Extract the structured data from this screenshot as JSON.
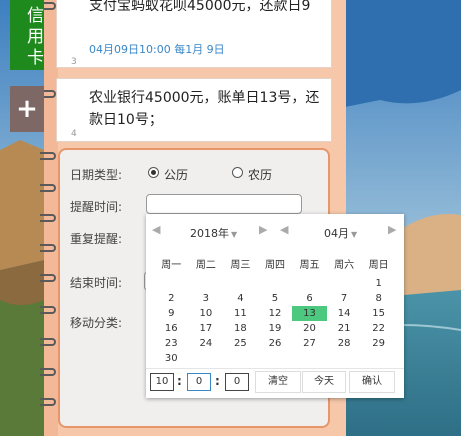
{
  "tab": {
    "label": "信用卡"
  },
  "add": {
    "label": "+"
  },
  "cards": [
    {
      "text": "支付宝蚂蚁花呗45000元，还款日9",
      "meta": "04月09日10:00 每1月 9日",
      "num": "3"
    },
    {
      "text": "农业银行45000元，账单日13号，还款日10号；",
      "num": "4"
    }
  ],
  "form": {
    "date_type_label": "日期类型:",
    "solar_label": "公历",
    "lunar_label": "农历",
    "remind_time_label": "提醒时间:",
    "remind_time_value": "",
    "repeat_label": "重复提醒:",
    "end_time_label": "结束时间:",
    "move_category_label": "移动分类:"
  },
  "picker": {
    "year": "2018年",
    "month": "04月",
    "weekdays": [
      "周一",
      "周二",
      "周三",
      "周四",
      "周五",
      "周六",
      "周日"
    ],
    "days": [
      "",
      "",
      "",
      "",
      "",
      "",
      "1",
      "2",
      "3",
      "4",
      "5",
      "6",
      "7",
      "8",
      "9",
      "10",
      "11",
      "12",
      "13",
      "14",
      "15",
      "16",
      "17",
      "18",
      "19",
      "20",
      "21",
      "22",
      "23",
      "24",
      "25",
      "26",
      "27",
      "28",
      "29",
      "30",
      "",
      "",
      "",
      "",
      "",
      ""
    ],
    "today": "13",
    "hour": "10",
    "minute": "0",
    "second": "0",
    "clear_label": "清空",
    "today_label": "今天",
    "confirm_label": "确认"
  },
  "colors": {
    "tab": "#1e8a1e",
    "accent": "#e8956a",
    "today": "#4cc97f",
    "meta": "#3a87c8"
  }
}
